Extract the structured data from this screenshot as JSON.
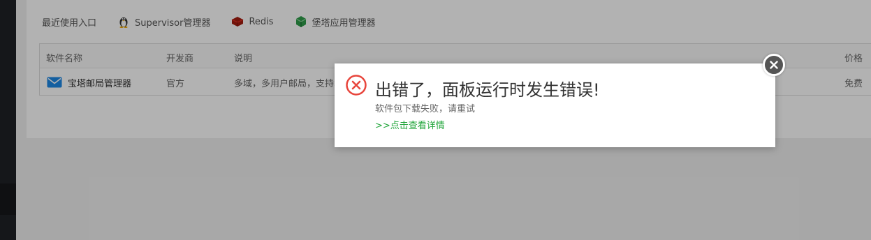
{
  "toolbar": {
    "recent_label": "最近使用入口",
    "items": [
      {
        "label": "Supervisor管理器",
        "icon": "penguin-icon"
      },
      {
        "label": "Redis",
        "icon": "redis-icon"
      },
      {
        "label": "堡塔应用管理器",
        "icon": "cube-icon"
      }
    ]
  },
  "table": {
    "headers": {
      "name": "软件名称",
      "developer": "开发商",
      "description": "说明",
      "price": "价格"
    },
    "rows": [
      {
        "name": "宝塔邮局管理器",
        "developer": "官方",
        "description": "多域，多用户邮局，支持S",
        "price": "免费"
      }
    ]
  },
  "dialog": {
    "title": "出错了，面板运行时发生错误!",
    "message": "软件包下载失败，请重试",
    "details_link": ">>点击查看详情"
  },
  "colors": {
    "accent_green": "#20a53a",
    "error_red": "#e8453c"
  }
}
